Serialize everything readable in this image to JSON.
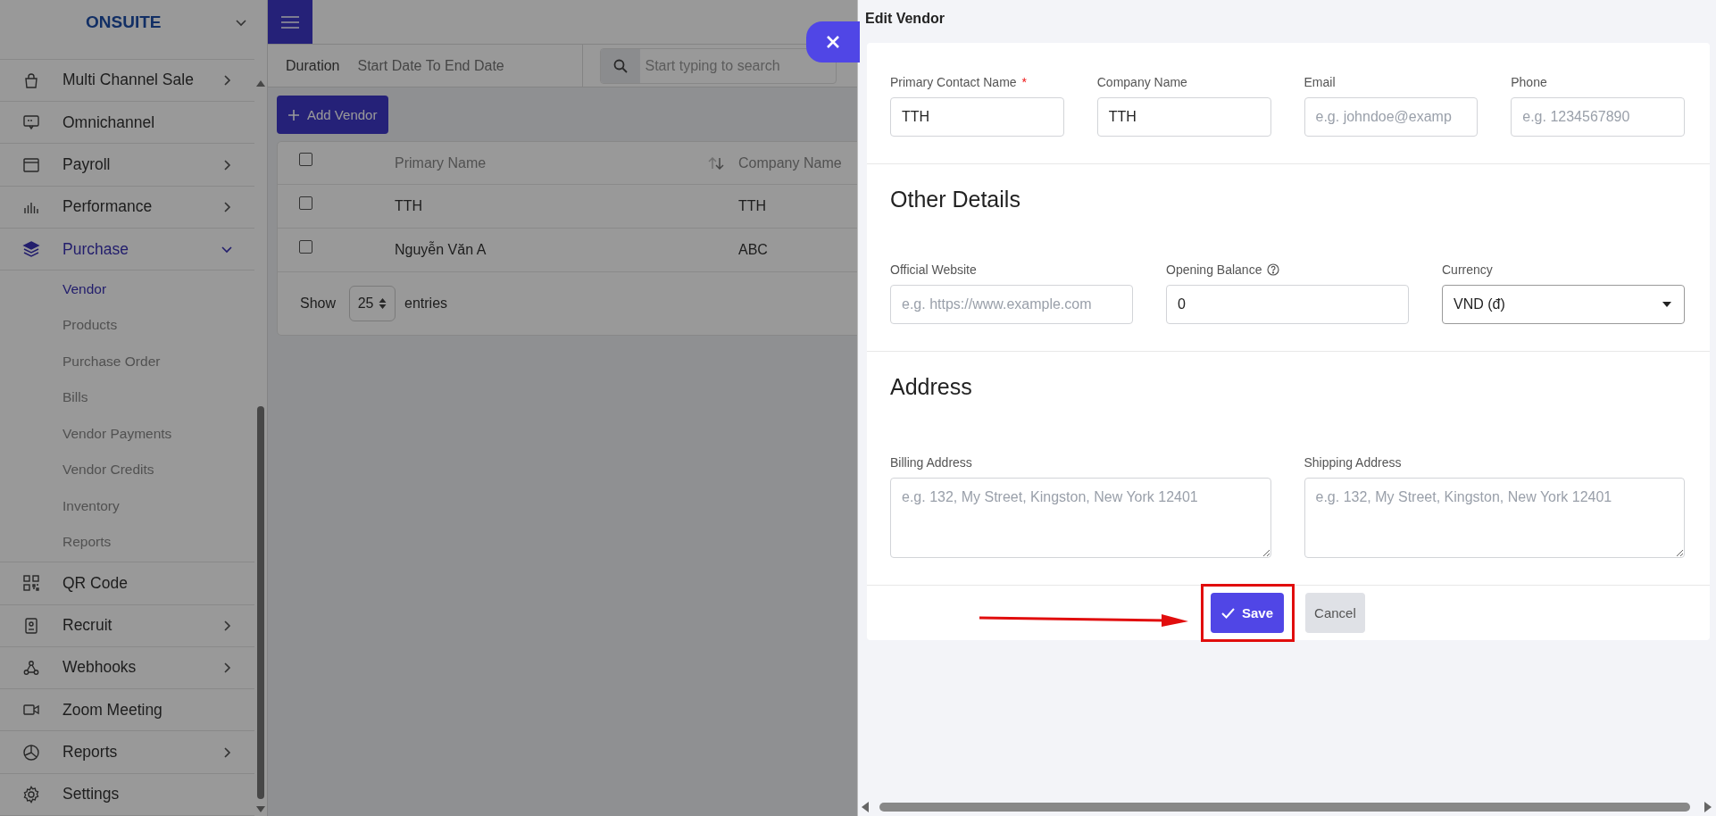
{
  "sidebar": {
    "brand": "ONSUITE",
    "items": [
      {
        "label": "Multi Channel Sale",
        "has_submenu": true,
        "expanded": false,
        "selected": false
      },
      {
        "label": "Omnichannel",
        "has_submenu": false,
        "selected": false
      },
      {
        "label": "Payroll",
        "has_submenu": true,
        "expanded": false,
        "selected": false
      },
      {
        "label": "Performance",
        "has_submenu": true,
        "expanded": false,
        "selected": false
      },
      {
        "label": "Purchase",
        "has_submenu": true,
        "expanded": true,
        "selected": true,
        "children": [
          {
            "label": "Vendor",
            "selected": true
          },
          {
            "label": "Products",
            "selected": false
          },
          {
            "label": "Purchase Order",
            "selected": false
          },
          {
            "label": "Bills",
            "selected": false
          },
          {
            "label": "Vendor Payments",
            "selected": false
          },
          {
            "label": "Vendor Credits",
            "selected": false
          },
          {
            "label": "Inventory",
            "selected": false
          },
          {
            "label": "Reports",
            "selected": false
          }
        ]
      },
      {
        "label": "QR Code",
        "has_submenu": false,
        "selected": false
      },
      {
        "label": "Recruit",
        "has_submenu": true,
        "expanded": false,
        "selected": false
      },
      {
        "label": "Webhooks",
        "has_submenu": true,
        "expanded": false,
        "selected": false
      },
      {
        "label": "Zoom Meeting",
        "has_submenu": false,
        "selected": false
      },
      {
        "label": "Reports",
        "has_submenu": true,
        "expanded": false,
        "selected": false
      },
      {
        "label": "Settings",
        "has_submenu": false,
        "selected": false
      }
    ]
  },
  "filter": {
    "duration_label": "Duration",
    "date_range_placeholder": "Start Date To End Date",
    "search_placeholder": "Start typing to search"
  },
  "add_button": "Add Vendor",
  "table": {
    "header_checked": false,
    "columns": [
      "Primary Name",
      "Company Name"
    ],
    "rows": [
      {
        "checked": false,
        "cells": [
          "TTH",
          "TTH"
        ]
      },
      {
        "checked": false,
        "cells": [
          "Nguyễn Văn A",
          "ABC"
        ]
      }
    ]
  },
  "pagination": {
    "show_label": "Show",
    "page_size": "25",
    "entries_label": "entries"
  },
  "drawer": {
    "title": "Edit Vendor",
    "sections": [
      {
        "fields": [
          {
            "kind": "text",
            "label": "Primary Contact Name",
            "required_mark": "*",
            "value": "TTH"
          },
          {
            "kind": "text",
            "label": "Company Name",
            "value": "TTH"
          },
          {
            "kind": "text",
            "label": "Email",
            "placeholder": "e.g. johndoe@examp"
          },
          {
            "kind": "text",
            "label": "Phone",
            "placeholder": "e.g. 1234567890"
          }
        ]
      },
      {
        "heading": "Other Details",
        "fields": [
          {
            "kind": "text",
            "label": "Official Website",
            "placeholder": "e.g. https://www.example.com"
          },
          {
            "kind": "text",
            "label": "Opening Balance",
            "help": true,
            "value": "0"
          },
          {
            "kind": "select",
            "label": "Currency",
            "value": "VND (đ)"
          }
        ]
      },
      {
        "heading": "Address",
        "fields": [
          {
            "kind": "textarea",
            "label": "Billing Address",
            "placeholder": "e.g. 132, My Street, Kingston, New York 12401"
          },
          {
            "kind": "textarea",
            "label": "Shipping Address",
            "placeholder": "e.g. 132, My Street, Kingston, New York 12401"
          }
        ]
      }
    ],
    "buttons": [
      {
        "kind": "primary",
        "label": "Save"
      },
      {
        "kind": "secondary",
        "label": "Cancel"
      }
    ]
  },
  "annotations": {
    "arrow": true,
    "save_highlight": true
  }
}
